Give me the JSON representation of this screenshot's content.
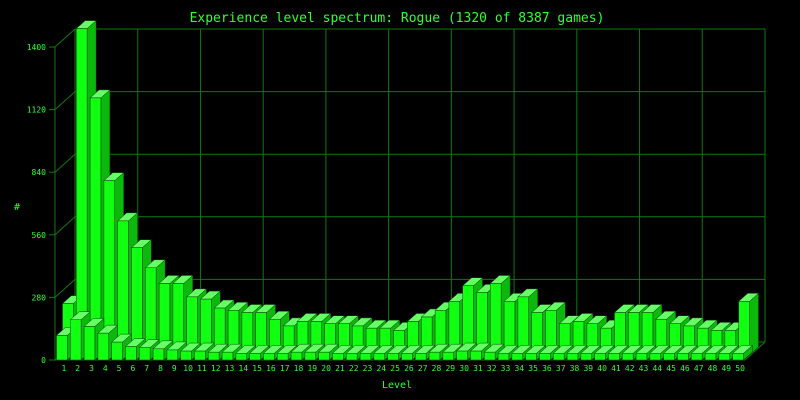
{
  "colors": {
    "background": "#000000",
    "grid": "#0d7a0d",
    "text": "#33ff33",
    "bar_front": "#11ff11",
    "bar_side": "#0bb80b",
    "bar_top": "#66ff66",
    "bar_edge": "#063d06"
  },
  "chart_data": {
    "type": "bar",
    "title": "Experience level spectrum: Rogue (1320 of 8387 games)",
    "xlabel": "Level",
    "ylabel": "#",
    "ylim": [
      0,
      1400
    ],
    "yticks": [
      0,
      280,
      560,
      840,
      1120,
      1400
    ],
    "grid": true,
    "style": "3d-stacked",
    "categories": [
      "1",
      "2",
      "3",
      "4",
      "5",
      "6",
      "7",
      "8",
      "9",
      "10",
      "11",
      "12",
      "13",
      "14",
      "15",
      "16",
      "17",
      "18",
      "19",
      "20",
      "21",
      "22",
      "23",
      "24",
      "25",
      "26",
      "27",
      "28",
      "29",
      "30",
      "31",
      "32",
      "33",
      "34",
      "35",
      "36",
      "37",
      "38",
      "39",
      "40",
      "41",
      "42",
      "43",
      "44",
      "45",
      "46",
      "47",
      "48",
      "49",
      "50"
    ],
    "series": [
      {
        "values": [
          230,
          1460,
          1150,
          780,
          600,
          480,
          390,
          320,
          320,
          260,
          250,
          210,
          200,
          190,
          190,
          160,
          130,
          150,
          150,
          140,
          140,
          130,
          120,
          120,
          110,
          150,
          170,
          200,
          240,
          310,
          280,
          320,
          240,
          260,
          190,
          200,
          140,
          150,
          140,
          120,
          190,
          190,
          190,
          160,
          140,
          130,
          120,
          110,
          110,
          240
        ]
      },
      {
        "values": [
          110,
          180,
          150,
          120,
          80,
          60,
          55,
          50,
          45,
          40,
          40,
          35,
          35,
          30,
          30,
          30,
          30,
          35,
          35,
          35,
          30,
          30,
          30,
          30,
          30,
          30,
          30,
          35,
          35,
          40,
          40,
          35,
          30,
          30,
          30,
          30,
          30,
          30,
          30,
          30,
          30,
          30,
          30,
          30,
          30,
          30,
          30,
          30,
          30,
          30
        ]
      }
    ]
  }
}
